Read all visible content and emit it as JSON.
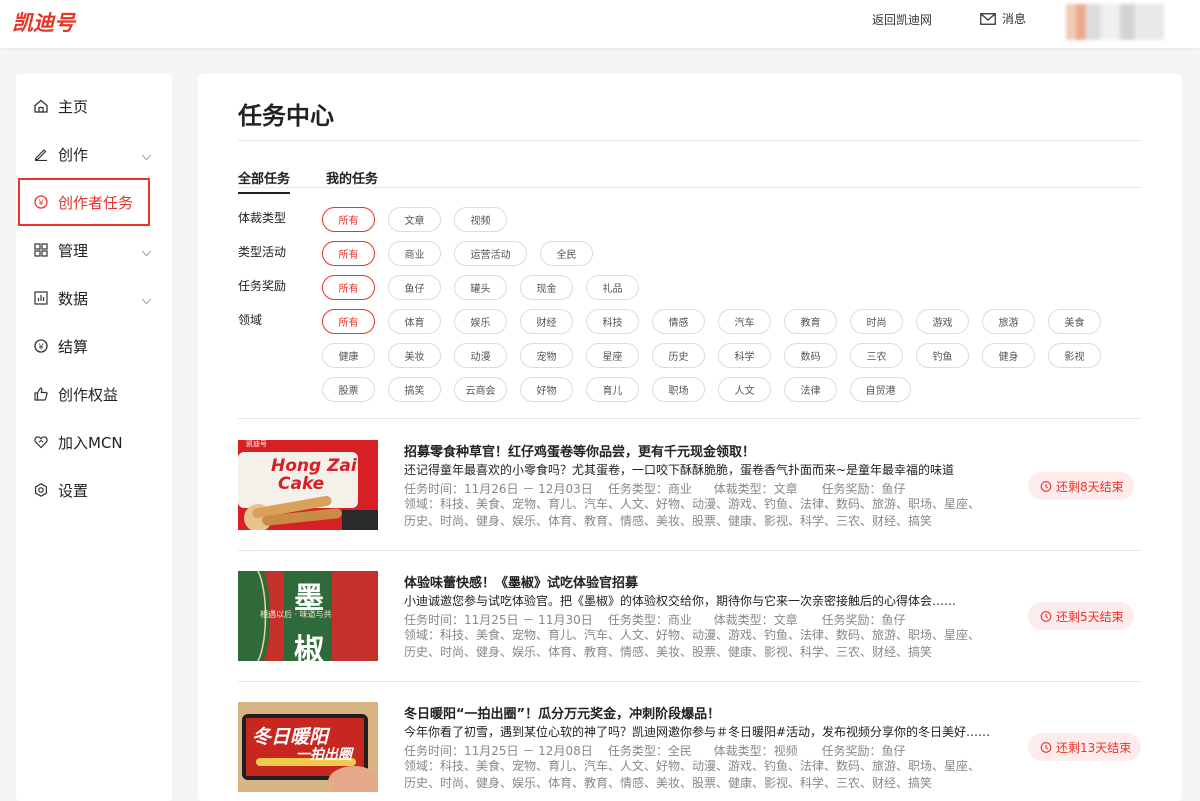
{
  "brand": {
    "logo": "凯迪号",
    "accent": "#e8332a"
  },
  "topbar": {
    "back_link": "返回凯迪网",
    "messages": "消息"
  },
  "sidebar": {
    "items": [
      {
        "label": "主页",
        "icon": "home-icon"
      },
      {
        "label": "创作",
        "icon": "pen-icon",
        "expandable": true
      },
      {
        "label": "创作者任务",
        "icon": "yuan-circle-icon",
        "active": true
      },
      {
        "label": "管理",
        "icon": "grid-icon",
        "expandable": true
      },
      {
        "label": "数据",
        "icon": "bar-chart-icon",
        "expandable": true
      },
      {
        "label": "结算",
        "icon": "yuan-settle-icon"
      },
      {
        "label": "创作权益",
        "icon": "thumbs-up-icon"
      },
      {
        "label": "加入MCN",
        "icon": "heart-link-icon"
      },
      {
        "label": "设置",
        "icon": "gear-icon"
      }
    ]
  },
  "main": {
    "title": "任务中心",
    "tabs": [
      {
        "label": "全部任务",
        "active": true
      },
      {
        "label": "我的任务",
        "active": false
      }
    ],
    "filters": {
      "type_label": "体裁类型",
      "type_options": [
        "所有",
        "文章",
        "视频"
      ],
      "activity_label": "类型活动",
      "activity_options": [
        "所有",
        "商业",
        "运营活动",
        "全民"
      ],
      "reward_label": "任务奖励",
      "reward_options": [
        "所有",
        "鱼仔",
        "罐头",
        "现金",
        "礼品"
      ],
      "domain_label": "领域",
      "domain_options": [
        "所有",
        "体育",
        "娱乐",
        "财经",
        "科技",
        "情感",
        "汽车",
        "教育",
        "时尚",
        "游戏",
        "旅游",
        "美食",
        "健康",
        "美妆",
        "动漫",
        "宠物",
        "星座",
        "历史",
        "科学",
        "数码",
        "三农",
        "钓鱼",
        "健身",
        "影视",
        "股票",
        "搞笑",
        "云商会",
        "好物",
        "育儿",
        "职场",
        "人文",
        "法律",
        "自贸港"
      ]
    },
    "tasks": [
      {
        "title": "招募零食种草官！红仔鸡蛋卷等你品尝，更有千元现金领取！",
        "subtitle": "还记得童年最喜欢的小零食吗？尤其蛋卷，一口咬下酥酥脆脆，蛋卷香气扑面而来~是童年最幸福的味道",
        "time": "任务时间：11月26日 － 12月03日",
        "task_type": "任务类型：商业",
        "genre": "体裁类型：文章",
        "reward": "任务奖励：鱼仔",
        "domains": "领域：科技、美食、宠物、育儿、汽车、人文、好物、动漫、游戏、钓鱼、法律、数码、旅游、职场、星座、历史、时尚、健身、娱乐、体育、教育、情感、美妆、股票、健康、影视、科学、三农、财经、搞笑",
        "remaining": "还剩8天结束",
        "image_text": [
          "Hong Zai",
          "Cake"
        ]
      },
      {
        "title": "体验味蕾快感！《墨椒》试吃体验官招募",
        "subtitle": "小迪诚邀您参与试吃体验官。把《墨椒》的体验权交给你，期待你与它来一次亲密接触后的心得体会……",
        "time": "任务时间：11月25日 － 11月30日",
        "task_type": "任务类型：商业",
        "genre": "体裁类型：文章",
        "reward": "任务奖励：鱼仔",
        "domains": "领域：科技、美食、宠物、育儿、汽车、人文、好物、动漫、游戏、钓鱼、法律、数码、旅游、职场、星座、历史、时尚、健身、娱乐、体育、教育、情感、美妆、股票、健康、影视、科学、三农、财经、搞笑",
        "remaining": "还剩5天结束",
        "image_text": [
          "墨",
          "椒",
          "相遇以后 · 味道与共"
        ]
      },
      {
        "title": "冬日暖阳“一拍出圈”！瓜分万元奖金，冲刺阶段爆品！",
        "subtitle": "今年你看了初雪，遇到某位心软的神了吗？凯迪网邀你参与＃冬日暖阳#活动，发布视频分享你的冬日美好……",
        "time": "任务时间：11月25日 － 12月08日",
        "task_type": "任务类型：全民",
        "genre": "体裁类型：视频",
        "reward": "任务奖励：鱼仔",
        "domains": "领域：科技、美食、宠物、育儿、汽车、人文、好物、动漫、游戏、钓鱼、法律、数码、旅游、职场、星座、历史、时尚、健身、娱乐、体育、教育、情感、美妆、股票、健康、影视、科学、三农、财经、搞笑",
        "remaining": "还剩13天结束",
        "image_text": [
          "冬日暖阳",
          "一拍出圈"
        ]
      }
    ]
  }
}
